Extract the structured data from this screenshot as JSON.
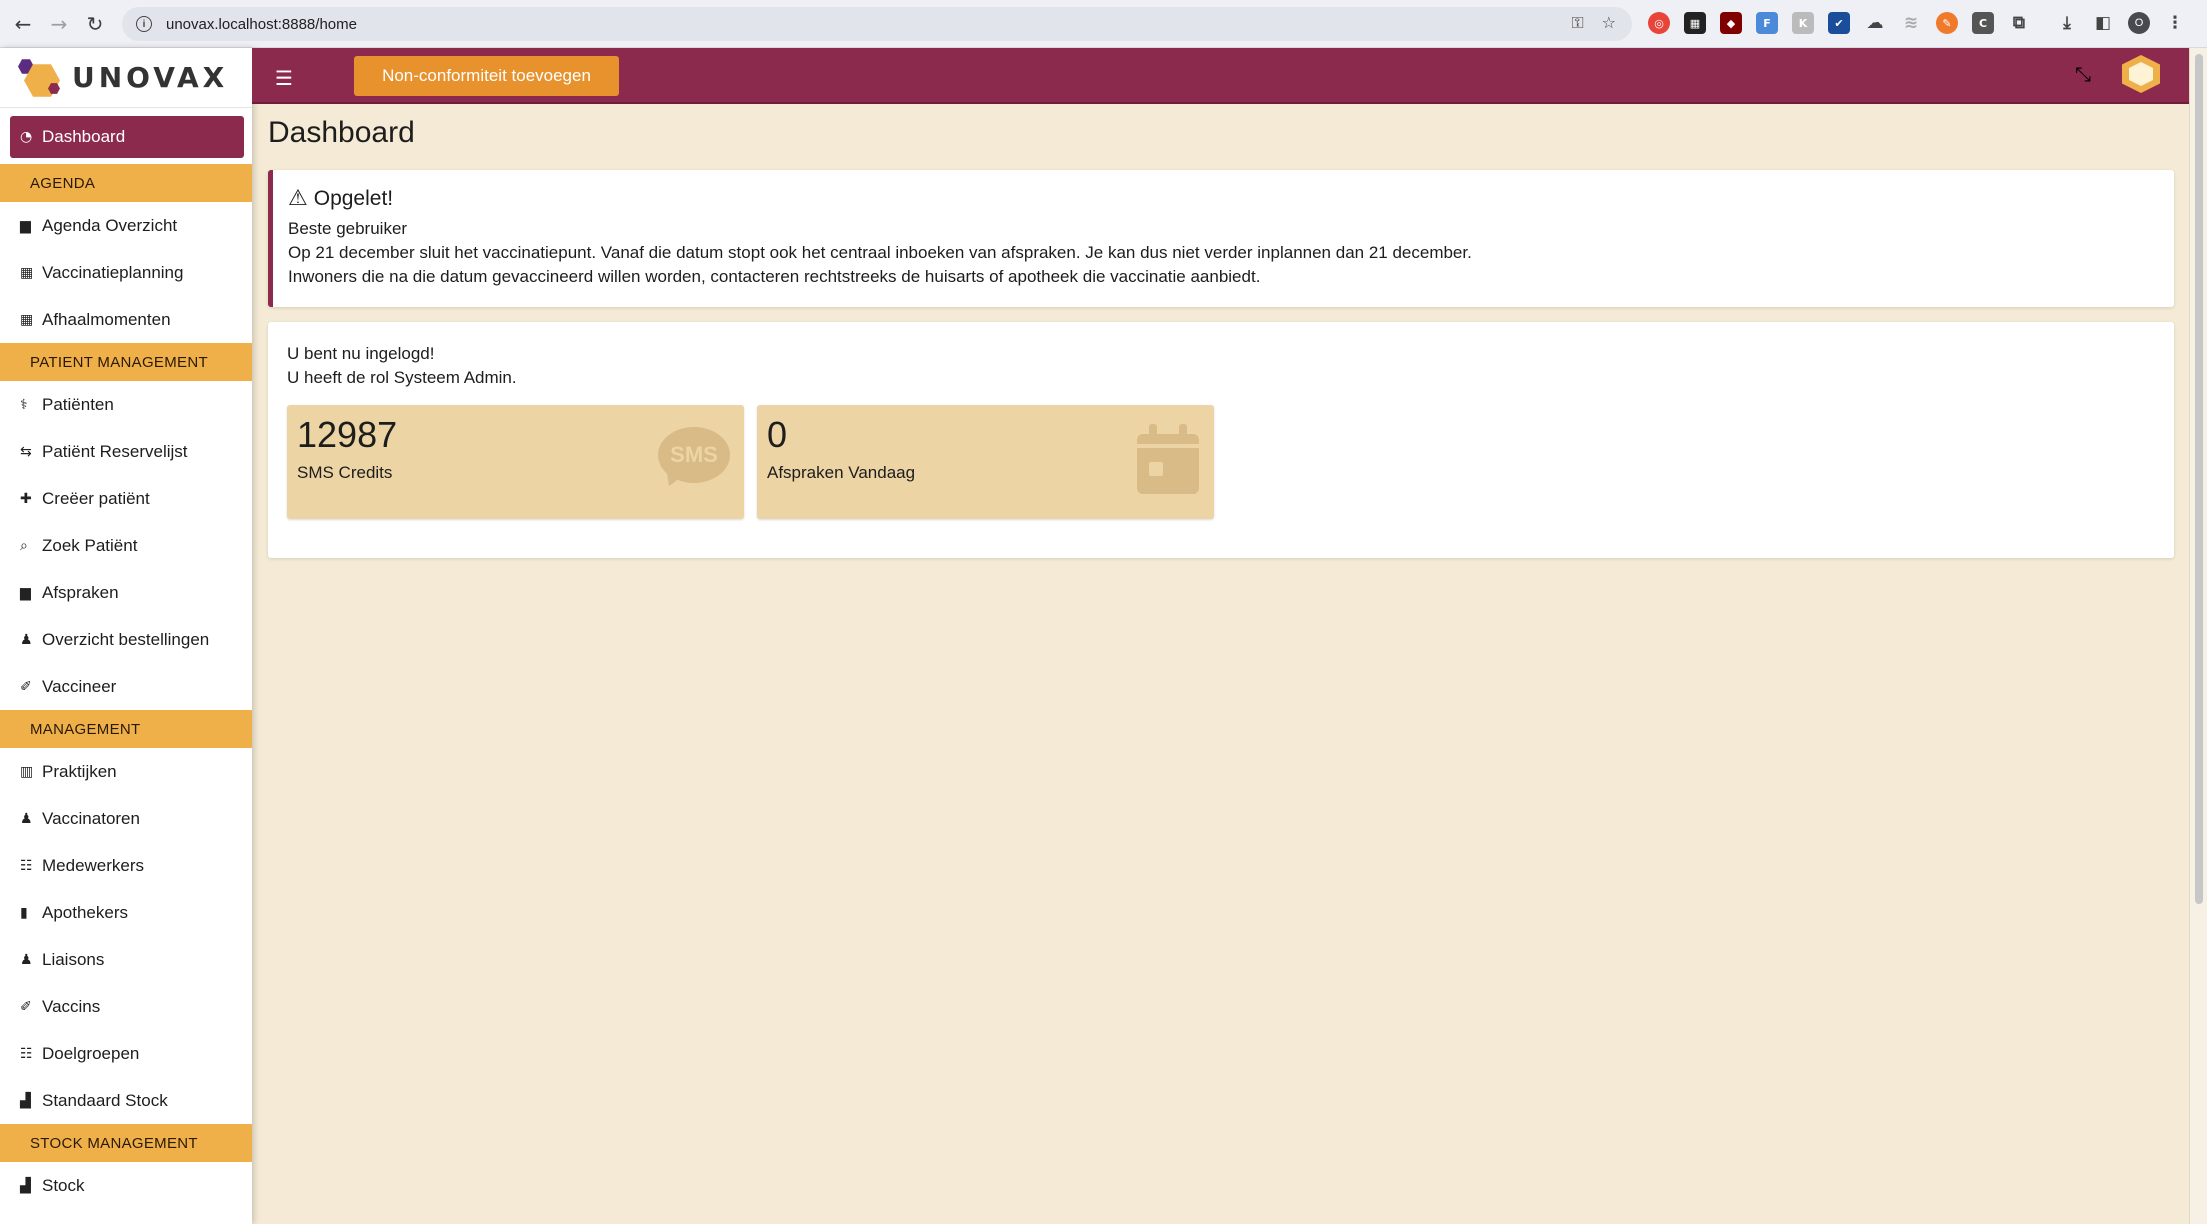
{
  "browser": {
    "url": "unovax.localhost:8888/home",
    "profile_initial": "O"
  },
  "brand": {
    "name": "UNOVAX"
  },
  "topbar": {
    "nonconformity_button": "Non-conformiteit toevoegen"
  },
  "sidebar": {
    "active": {
      "label": "Dashboard",
      "icon": "gauge-icon"
    },
    "sections": [
      {
        "header": "AGENDA",
        "items": [
          {
            "label": "Agenda Overzicht",
            "icon": "calendar-icon"
          },
          {
            "label": "Vaccinatieplanning",
            "icon": "calendar-grid-icon"
          },
          {
            "label": "Afhaalmomenten",
            "icon": "calendar-grid-icon"
          }
        ]
      },
      {
        "header": "PATIENT MANAGEMENT",
        "items": [
          {
            "label": "Patiënten",
            "icon": "hospital-user-icon"
          },
          {
            "label": "Patiënt Reservelijst",
            "icon": "people-arrows-icon"
          },
          {
            "label": "Creëer patiënt",
            "icon": "user-plus-icon"
          },
          {
            "label": "Zoek Patiënt",
            "icon": "search-icon"
          },
          {
            "label": "Afspraken",
            "icon": "calendar-icon"
          },
          {
            "label": "Overzicht bestellingen",
            "icon": "user-doctor-icon"
          },
          {
            "label": "Vaccineer",
            "icon": "syringe-icon"
          }
        ]
      },
      {
        "header": "MANAGEMENT",
        "items": [
          {
            "label": "Praktijken",
            "icon": "building-icon"
          },
          {
            "label": "Vaccinatoren",
            "icon": "user-doctor-icon"
          },
          {
            "label": "Medewerkers",
            "icon": "users-icon"
          },
          {
            "label": "Apothekers",
            "icon": "prescription-bottle-icon"
          },
          {
            "label": "Liaisons",
            "icon": "user-icon"
          },
          {
            "label": "Vaccins",
            "icon": "syringe-icon"
          },
          {
            "label": "Doelgroepen",
            "icon": "users-icon"
          },
          {
            "label": "Standaard Stock",
            "icon": "boxes-icon"
          }
        ]
      },
      {
        "header": "STOCK MANAGEMENT",
        "items": [
          {
            "label": "Stock",
            "icon": "boxes-icon"
          }
        ]
      }
    ]
  },
  "main": {
    "title": "Dashboard",
    "alert": {
      "title": "Opgelet!",
      "lines": [
        "Beste gebruiker",
        "Op 21 december sluit het vaccinatiepunt. Vanaf die datum stopt ook het centraal inboeken van afspraken. Je kan dus niet verder inplannen dan 21 december.",
        "Inwoners die na die datum gevaccineerd willen worden, contacteren rechtstreeks de huisarts of apotheek die vaccinatie aanbiedt."
      ]
    },
    "welcome": {
      "line1": "U bent nu ingelogd!",
      "line2": "U heeft de rol Systeem Admin."
    },
    "stats": [
      {
        "value": "12987",
        "label": "SMS Credits",
        "icon": "sms-icon"
      },
      {
        "value": "0",
        "label": "Afspraken Vandaag",
        "icon": "calendar-icon"
      }
    ]
  },
  "colors": {
    "brand_primary": "#8c2a4e",
    "brand_accent": "#efb04a",
    "button_orange": "#e8922d",
    "background": "#f4ead5",
    "info_box": "#ecd4a4"
  }
}
